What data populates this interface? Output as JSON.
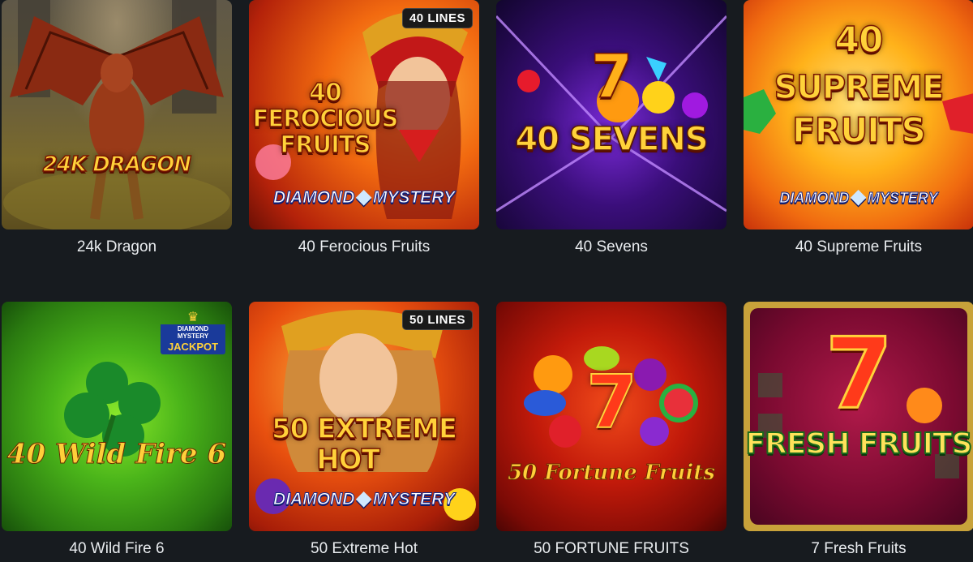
{
  "games": [
    {
      "title": "24k Dragon",
      "logo": "24K DRAGON"
    },
    {
      "title": "40 Ferocious Fruits",
      "logo_lines": [
        "40",
        "FEROCIOUS",
        "FRUITS"
      ],
      "badge": "40 LINES",
      "subbrand": "DIAMOND",
      "subbrand2": "MYSTERY"
    },
    {
      "title": "40 Sevens",
      "logo": "40 SEVENS",
      "seven": "7"
    },
    {
      "title": "40 Supreme Fruits",
      "logo_lines": [
        "40",
        "SUPREME",
        "FRUITS"
      ],
      "subbrand": "DIAMOND",
      "subbrand2": "MYSTERY"
    },
    {
      "title": "40 Wild Fire 6",
      "logo": "40 Wild Fire 6",
      "jackpot_top": "DIAMOND MYSTERY",
      "jackpot": "JACKPOT"
    },
    {
      "title": "50 Extreme Hot",
      "logo_lines": [
        "50 EXTREME",
        "HOT"
      ],
      "badge": "50 LINES",
      "subbrand": "DIAMOND",
      "subbrand2": "MYSTERY"
    },
    {
      "title": "50 FORTUNE FRUITS",
      "logo": "50 Fortune Fruits",
      "seven": "7"
    },
    {
      "title": "7 Fresh Fruits",
      "logo": "FRESH FRUITS",
      "seven": "7"
    }
  ],
  "colors": {
    "page_bg": "#171b1f",
    "title_text": "#e9ecef"
  }
}
